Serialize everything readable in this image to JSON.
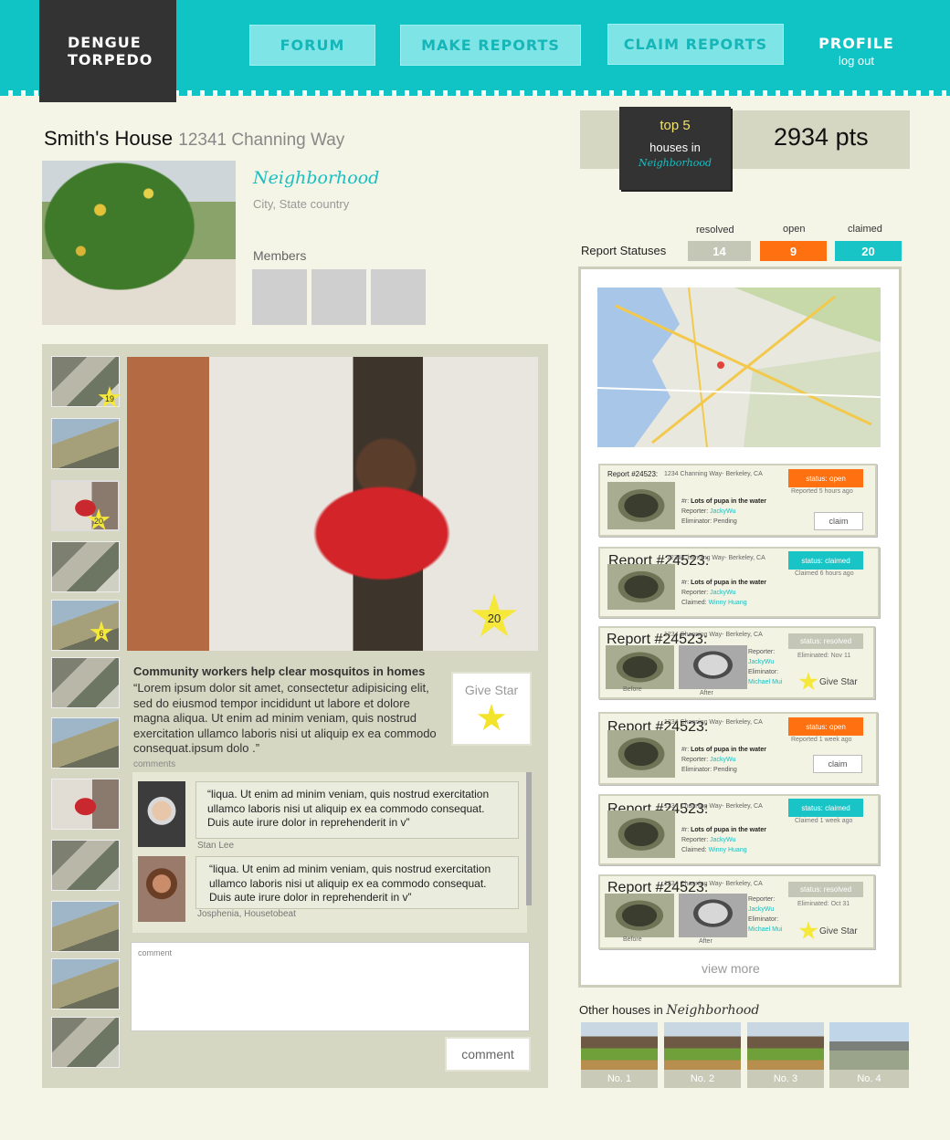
{
  "header": {
    "logo_line1": "DENGUE",
    "logo_line2": "TORPEDO",
    "nav": [
      "FORUM",
      "MAKE REPORTS",
      "CLAIM REPORTS"
    ],
    "profile": "PROFILE",
    "logout": "log out"
  },
  "house": {
    "name": "Smith's House",
    "address": "12341 Channing Way",
    "neighborhood": "Neighborhood",
    "location": "City, State country",
    "members_label": "Members"
  },
  "stats": {
    "top_label": "top 5",
    "houses_in": "houses in",
    "neighborhood": "Neighborhood",
    "points": "2934 pts",
    "statuses_label": "Report Statuses",
    "resolved_label": "resolved",
    "open_label": "open",
    "claimed_label": "claimed",
    "resolved_count": "14",
    "open_count": "9",
    "claimed_count": "20"
  },
  "feed": {
    "thumb_stars": [
      "19",
      "20",
      "6"
    ],
    "main_star": "20",
    "post_title": "Community workers help clear mosquitos in homes",
    "post_body": "“Lorem ipsum dolor sit amet, consectetur adipisicing elit, sed do eiusmod tempor incididunt ut labore et dolore magna aliqua. Ut enim ad minim veniam, quis nostrud exercitation ullamco laboris nisi ut aliquip ex ea commodo consequat.ipsum dolo .”",
    "give_star": "Give Star",
    "comments_label": "comments",
    "comments": [
      {
        "text": "“liqua. Ut enim ad minim veniam, quis nostrud exercitation ullamco laboris nisi ut aliquip ex ea commodo consequat. Duis aute irure dolor in reprehenderit in v”",
        "author": "Stan Lee"
      },
      {
        "text": "“liqua. Ut enim ad minim veniam, quis nostrud exercitation ullamco laboris nisi ut aliquip ex ea commodo consequat. Duis aute irure dolor in reprehenderit in v”",
        "author": "Josphenia, Housetobeat"
      }
    ],
    "comment_placeholder": "comment",
    "comment_button": "comment"
  },
  "reports": {
    "items": [
      {
        "id": "Report #24523:",
        "addr": "1234 Channing Way- Berkeley, CA",
        "status": "status: open",
        "time": "Reported 5 hours ago",
        "title_prefix": "#r:",
        "title": "Lots of pupa in the water",
        "reporter_label": "Reporter:",
        "reporter": "JackyWu",
        "third_label": "Eliminator:",
        "third": "Pending",
        "claim": "claim"
      },
      {
        "id": "Report #24523:",
        "addr": "1234 Channing Way- Berkeley, CA",
        "status": "status: claimed",
        "time": "Claimed 6 hours ago",
        "title_prefix": "#r:",
        "title": "Lots of pupa in the water",
        "reporter_label": "Reporter:",
        "reporter": "JackyWu",
        "third_label": "Claimed:",
        "third": "Winny Huang"
      },
      {
        "id": "Report #24523:",
        "addr": "1234 Channing Way- Berkeley, CA",
        "status": "status: resolved",
        "time": "Eliminated: Nov 11",
        "reporter_label": "Reporter:",
        "reporter": "JackyWu",
        "third_label": "Eliminator:",
        "third": "Michael Mui",
        "before": "Before",
        "after": "After",
        "give_star": "Give Star"
      },
      {
        "id": "Report #24523:",
        "addr": "1234 Channing Way- Berkeley, CA",
        "status": "status: open",
        "time": "Reported 1 week ago",
        "title_prefix": "#r:",
        "title": "Lots of pupa in the water",
        "reporter_label": "Reporter:",
        "reporter": "JackyWu",
        "third_label": "Eliminator:",
        "third": "Pending",
        "claim": "claim"
      },
      {
        "id": "Report #24523:",
        "addr": "1234 Channing Way- Berkeley, CA",
        "status": "status: claimed",
        "time": "Claimed 1 week ago",
        "title_prefix": "#r:",
        "title": "Lots of pupa in the water",
        "reporter_label": "Reporter:",
        "reporter": "JackyWu",
        "third_label": "Claimed:",
        "third": "Winny Huang"
      },
      {
        "id": "Report #24523:",
        "addr": "1234 Channing Way- Berkeley, CA",
        "status": "status: resolved",
        "time": "Eliminated: Oct 31",
        "reporter_label": "Reporter:",
        "reporter": "JackyWu",
        "third_label": "Eliminator:",
        "third": "Michael Mui",
        "before": "Before",
        "after": "After",
        "give_star": "Give Star"
      }
    ],
    "view_more": "view more"
  },
  "other_houses": {
    "label": "Other houses in",
    "neighborhood": "Neighborhood",
    "houses": [
      "No. 1",
      "No. 2",
      "No. 3",
      "No. 4"
    ]
  },
  "colors": {
    "header": "#10c4c6",
    "open": "#ff7010",
    "claimed": "#18c4c6",
    "resolved": "#c5c7b6"
  }
}
